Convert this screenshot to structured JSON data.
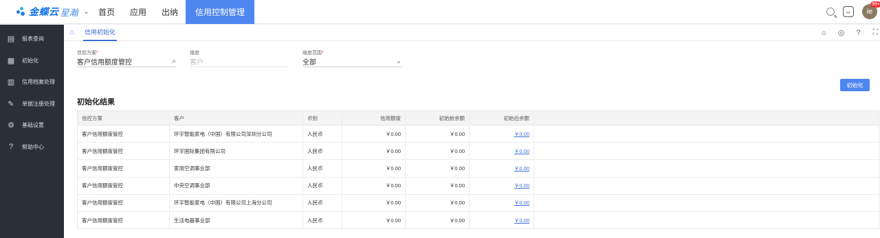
{
  "header": {
    "brand": "金蝶云",
    "brand_sub": "星瀚",
    "nav": [
      "首页",
      "应用",
      "出纳",
      "信用控制管理"
    ],
    "avatar_text": "ie",
    "avatar_badge": "99+"
  },
  "sidebar": {
    "items": [
      {
        "label": "报表查询",
        "icon": "report-icon"
      },
      {
        "label": "初始化",
        "icon": "init-icon"
      },
      {
        "label": "信用档案处理",
        "icon": "archive-icon"
      },
      {
        "label": "单据注册处理",
        "icon": "document-icon"
      },
      {
        "label": "基础设置",
        "icon": "gear-icon"
      },
      {
        "label": "帮助中心",
        "icon": "help-icon"
      }
    ]
  },
  "tab": {
    "label": "信用初始化"
  },
  "filters": {
    "scheme_label": "信控方案",
    "scheme_value": "客户信用额度管控",
    "dimension_label": "维度",
    "dimension_value": "客户",
    "range_label": "维度范围",
    "range_value": "全部"
  },
  "init_button": "初始化",
  "section_title": "初始化结果",
  "table": {
    "headers": [
      "信控方案",
      "客户",
      "币别",
      "信用额度",
      "初始前余额",
      "初始后余额"
    ],
    "rows": [
      [
        "客户信用额度管控",
        "环宇智能家电（中国）有限公司深圳分公司",
        "人民币",
        "￥0.00",
        "￥0.00",
        "￥0.00"
      ],
      [
        "客户信用额度管控",
        "环宇国际集团有限公司",
        "人民币",
        "￥0.00",
        "￥0.00",
        "￥0.00"
      ],
      [
        "客户信用额度管控",
        "家用空调事业部",
        "人民币",
        "￥0.00",
        "￥0.00",
        "￥0.00"
      ],
      [
        "客户信用额度管控",
        "中央空调事业部",
        "人民币",
        "￥0.00",
        "￥0.00",
        "￥0.00"
      ],
      [
        "客户信用额度管控",
        "环宇智能家电（中国）有限公司上海分公司",
        "人民币",
        "￥0.00",
        "￥0.00",
        "￥0.00"
      ],
      [
        "客户信用额度管控",
        "生活电器事业部",
        "人民币",
        "￥0.00",
        "￥0.00",
        "￥0.00"
      ]
    ]
  },
  "colors": {
    "accent": "#4e86f0",
    "sidebar_bg": "#2b2f3a"
  }
}
